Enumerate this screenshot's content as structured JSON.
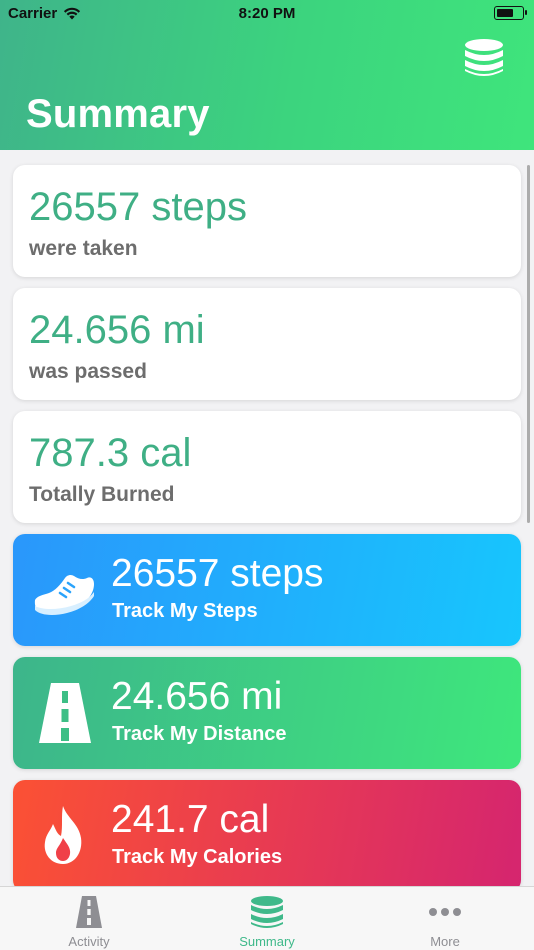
{
  "status_bar": {
    "carrier": "Carrier",
    "time": "8:20 PM",
    "battery_level": 0.7
  },
  "header": {
    "title": "Summary",
    "action_icon": "database-icon"
  },
  "stats": [
    {
      "value": "26557 steps",
      "label": "were taken"
    },
    {
      "value": "24.656 mi",
      "label": "was passed"
    },
    {
      "value": "787.3 cal",
      "label": "Totally Burned"
    }
  ],
  "tracks": [
    {
      "value": "26557 steps",
      "label": "Track My Steps",
      "icon": "shoe-icon",
      "colors": [
        "#2a97fb",
        "#17c6fd"
      ]
    },
    {
      "value": "24.656 mi",
      "label": "Track My Distance",
      "icon": "road-icon",
      "colors": [
        "#3db58b",
        "#3ee77c"
      ]
    },
    {
      "value": "241.7 cal",
      "label": "Track My Calories",
      "icon": "flame-icon",
      "colors": [
        "#fb5134",
        "#d5256f"
      ]
    }
  ],
  "tabs": [
    {
      "label": "Activity",
      "icon": "road-icon",
      "active": false
    },
    {
      "label": "Summary",
      "icon": "database-icon",
      "active": true
    },
    {
      "label": "More",
      "icon": "more-icon",
      "active": false
    }
  ],
  "colors": {
    "accent": "#3fb98a",
    "stat_value": "#3faf85",
    "inactive_tab": "#8e8e93"
  }
}
